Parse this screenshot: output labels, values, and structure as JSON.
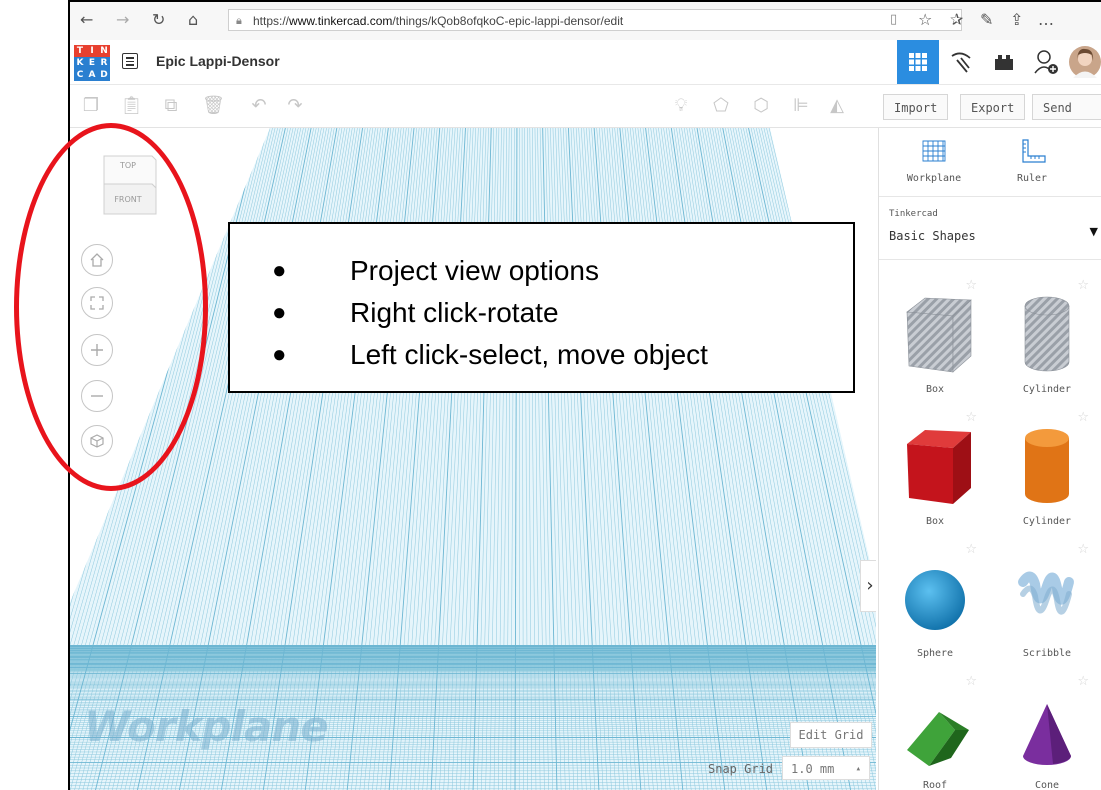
{
  "browser": {
    "url_prefix": "https://",
    "url_domain": "www.tinkercad.com",
    "url_path": "/things/kQob8ofqkoC-epic-lappi-densor/edit"
  },
  "app": {
    "logo_letters": [
      "T",
      "I",
      "N",
      "K",
      "E",
      "R",
      "C",
      "A",
      "D"
    ],
    "logo_colors": [
      "#e8402f",
      "#e8402f",
      "#e8402f",
      "#2a7fd0",
      "#2a7fd0",
      "#2a7fd0",
      "#2a7fd0",
      "#2a7fd0",
      "#2a7fd0"
    ],
    "project_title": "Epic Lappi-Densor",
    "accent": "#2b8de0"
  },
  "toolbar": {
    "import_label": "Import",
    "export_label": "Export",
    "send_to_label": "Send To"
  },
  "viewcube": {
    "top_label": "TOP",
    "front_label": "FRONT"
  },
  "canvas": {
    "workplane_label": "Workplane",
    "edit_grid_label": "Edit Grid",
    "snap_grid_label": "Snap Grid",
    "snap_grid_value": "1.0 mm"
  },
  "panel": {
    "workplane_label": "Workplane",
    "ruler_label": "Ruler",
    "library_source": "Tinkercad",
    "library_name": "Basic Shapes",
    "shapes": [
      {
        "label": "Box"
      },
      {
        "label": "Cylinder"
      },
      {
        "label": "Box"
      },
      {
        "label": "Cylinder"
      },
      {
        "label": "Sphere"
      },
      {
        "label": "Scribble"
      },
      {
        "label": "Roof"
      },
      {
        "label": "Cone"
      }
    ]
  },
  "annotation": {
    "items": [
      "Project view options",
      "Right click-rotate",
      "Left click-select, move object"
    ],
    "ring_color": "#e8141c"
  }
}
